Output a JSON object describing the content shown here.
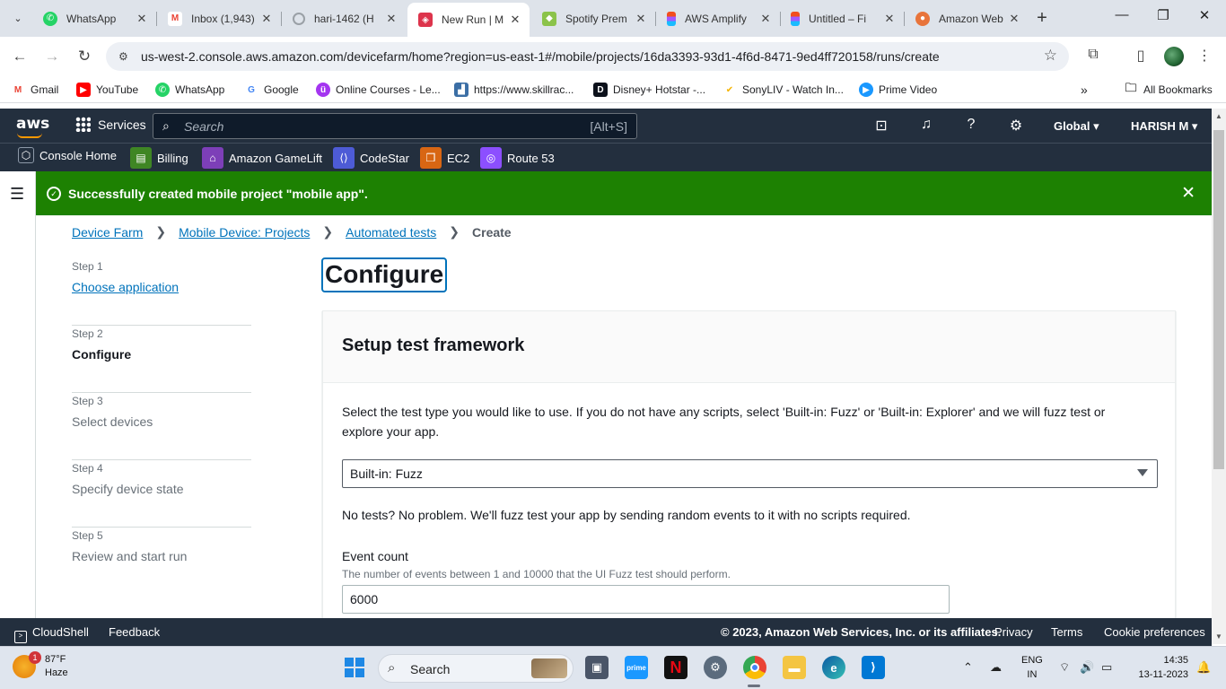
{
  "browser": {
    "tabs": [
      {
        "title": "WhatsApp",
        "icon": "whatsapp-icon",
        "color": "#25d366"
      },
      {
        "title": "Inbox (1,943)",
        "icon": "gmail-icon",
        "color": "#ea4335"
      },
      {
        "title": "hari-1462 (H",
        "icon": "loading-icon",
        "color": "#9aa0a6"
      },
      {
        "title": "New Run | M",
        "icon": "devicefarm-icon",
        "color": "#dd344c"
      },
      {
        "title": "Spotify Prem",
        "icon": "spotify-icon",
        "color": "#8bc34a"
      },
      {
        "title": "AWS Amplify",
        "icon": "figma-icon",
        "color": "#f24e1e"
      },
      {
        "title": "Untitled – Fi",
        "icon": "figma-icon",
        "color": "#f24e1e"
      },
      {
        "title": "Amazon Web",
        "icon": "aws-icon",
        "color": "#e8743b"
      }
    ],
    "url": "us-west-2.console.aws.amazon.com/devicefarm/home?region=us-east-1#/mobile/projects/16da3393-93d1-4f6d-8471-9ed4ff720158/runs/create",
    "bookmarks": [
      {
        "label": "Gmail",
        "icon": "gmail-icon",
        "color": "#ea4335"
      },
      {
        "label": "YouTube",
        "icon": "youtube-icon",
        "color": "#ff0000"
      },
      {
        "label": "WhatsApp",
        "icon": "whatsapp-icon",
        "color": "#25d366"
      },
      {
        "label": "Google",
        "icon": "google-icon",
        "color": "#4285f4"
      },
      {
        "label": "Online Courses - Le...",
        "icon": "udemy-icon",
        "color": "#a435f0"
      },
      {
        "label": "https://www.skillrac...",
        "icon": "skillrack-icon",
        "color": "#3b6ea5"
      },
      {
        "label": "Disney+ Hotstar -...",
        "icon": "hotstar-icon",
        "color": "#0c111b"
      },
      {
        "label": "SonyLIV - Watch In...",
        "icon": "sonyliv-icon",
        "color": "#f5b400"
      },
      {
        "label": "Prime Video",
        "icon": "primevideo-icon",
        "color": "#1a98ff"
      }
    ],
    "all_bookmarks": "All Bookmarks"
  },
  "aws": {
    "logo": "aws",
    "services": "Services",
    "search_placeholder": "Search",
    "search_hint": "[Alt+S]",
    "region": "Global",
    "user": "HARISH M",
    "favorites": [
      {
        "label": "Console Home",
        "icon": "console-home-icon",
        "color": "#414d5c"
      },
      {
        "label": "Billing",
        "icon": "billing-icon",
        "color": "#3f8624"
      },
      {
        "label": "Amazon GameLift",
        "icon": "gamelift-icon",
        "color": "#7d3fb8"
      },
      {
        "label": "CodeStar",
        "icon": "codestar-icon",
        "color": "#4d5bd6"
      },
      {
        "label": "EC2",
        "icon": "ec2-icon",
        "color": "#d86613"
      },
      {
        "label": "Route 53",
        "icon": "route53-icon",
        "color": "#8c4fff"
      }
    ],
    "flash_message": "Successfully created mobile project \"mobile app\".",
    "breadcrumb": [
      "Device Farm",
      "Mobile Device: Projects",
      "Automated tests"
    ],
    "breadcrumb_current": "Create",
    "steps": [
      {
        "num": "Step 1",
        "name": "Choose application"
      },
      {
        "num": "Step 2",
        "name": "Configure"
      },
      {
        "num": "Step 3",
        "name": "Select devices"
      },
      {
        "num": "Step 4",
        "name": "Specify device state"
      },
      {
        "num": "Step 5",
        "name": "Review and start run"
      }
    ],
    "page_title": "Configure",
    "panel": {
      "title": "Setup test framework",
      "description": "Select the test type you would like to use. If you do not have any scripts, select 'Built-in: Fuzz' or 'Built-in: Explorer' and we will fuzz test or explore your app.",
      "test_type": "Built-in: Fuzz",
      "no_tests": "No tests? No problem. We'll fuzz test your app by sending random events to it with no scripts required.",
      "event_count_label": "Event count",
      "event_count_help": "The number of events between 1 and 10000 that the UI Fuzz test should perform.",
      "event_count_value": "6000"
    },
    "footer": {
      "cloudshell": "CloudShell",
      "feedback": "Feedback",
      "copyright": "© 2023, Amazon Web Services, Inc. or its affiliates.",
      "privacy": "Privacy",
      "terms": "Terms",
      "cookies": "Cookie preferences"
    }
  },
  "taskbar": {
    "temperature": "87°F",
    "condition": "Haze",
    "weather_badge": "1",
    "search": "Search",
    "lang1": "ENG",
    "lang2": "IN",
    "time": "14:35",
    "date": "13-11-2023"
  }
}
